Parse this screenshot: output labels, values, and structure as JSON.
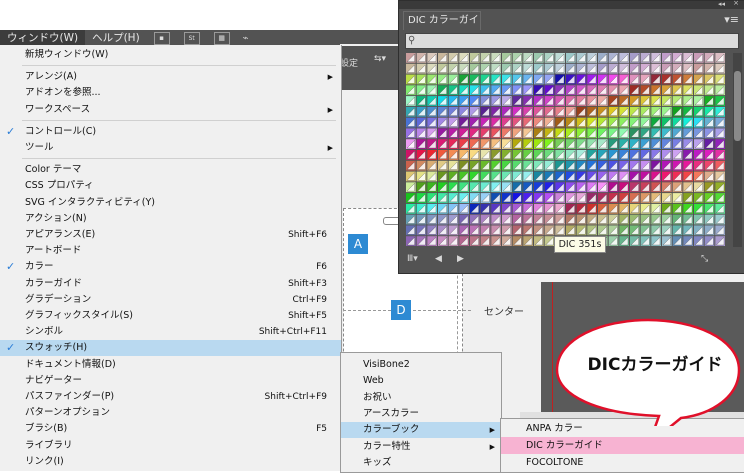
{
  "menubar": {
    "items": [
      "ウィンドウ(W)",
      "ヘルプ(H)"
    ],
    "icons": [
      "bridge-icon",
      "stock-icon",
      "layout-icon",
      "gpu-icon"
    ]
  },
  "control": {
    "text": "設定"
  },
  "window_menu": [
    {
      "label": "新規ウィンドウ(W)"
    },
    {
      "sep": true
    },
    {
      "label": "アレンジ(A)",
      "submenu": true
    },
    {
      "label": "アドオンを参照..."
    },
    {
      "label": "ワークスペース",
      "submenu": true
    },
    {
      "sep": true
    },
    {
      "label": "コントロール(C)",
      "checked": true
    },
    {
      "label": "ツール",
      "submenu": true
    },
    {
      "sep": true
    },
    {
      "label": "Color テーマ"
    },
    {
      "label": "CSS プロパティ"
    },
    {
      "label": "SVG インタラクティビティ(Y)"
    },
    {
      "label": "アクション(N)"
    },
    {
      "label": "アピアランス(E)",
      "shortcut": "Shift+F6"
    },
    {
      "label": "アートボード"
    },
    {
      "label": "カラー",
      "shortcut": "F6",
      "checked": true
    },
    {
      "label": "カラーガイド",
      "shortcut": "Shift+F3"
    },
    {
      "label": "グラデーション",
      "shortcut": "Ctrl+F9"
    },
    {
      "label": "グラフィックスタイル(S)",
      "shortcut": "Shift+F5"
    },
    {
      "label": "シンボル",
      "shortcut": "Shift+Ctrl+F11"
    },
    {
      "label": "スウォッチ(H)",
      "checked": true,
      "highlight": true
    },
    {
      "label": "ドキュメント情報(D)"
    },
    {
      "label": "ナビゲーター"
    },
    {
      "label": "パスファインダー(P)",
      "shortcut": "Shift+Ctrl+F9"
    },
    {
      "label": "パターンオプション"
    },
    {
      "label": "ブラシ(B)",
      "shortcut": "F5"
    },
    {
      "label": "ライブラリ"
    },
    {
      "label": "リンク(I)"
    }
  ],
  "swatch_submenu": [
    {
      "label": "VisiBone2"
    },
    {
      "label": "Web"
    },
    {
      "label": "お祝い"
    },
    {
      "label": "アースカラー"
    },
    {
      "label": "カラーブック",
      "submenu": true,
      "highlight": true
    },
    {
      "label": "カラー特性",
      "submenu": true
    },
    {
      "label": "キッズ"
    }
  ],
  "colorbook_submenu": [
    {
      "label": "ANPA カラー"
    },
    {
      "label": "DIC カラーガイド",
      "highlight": true
    },
    {
      "label": "FOCOLTONE"
    }
  ],
  "panel": {
    "tab": "DIC カラーガイド",
    "tooltip": "DIC 351s",
    "collapse_icon": "◂◂",
    "close_icon": "×"
  },
  "artboard": {
    "label_a": "A",
    "label_d": "D",
    "center_label": "センター"
  },
  "callout": {
    "text": "DICカラーガイド",
    "fill": "#ffffff",
    "stroke": "#e0102a"
  },
  "colors": {
    "menu_bg": "#f0f0f0",
    "highlight": "#b9d9f0",
    "pink": "#f7b3d2",
    "accent": "#2d8ad3",
    "panel_bg": "#535353"
  }
}
